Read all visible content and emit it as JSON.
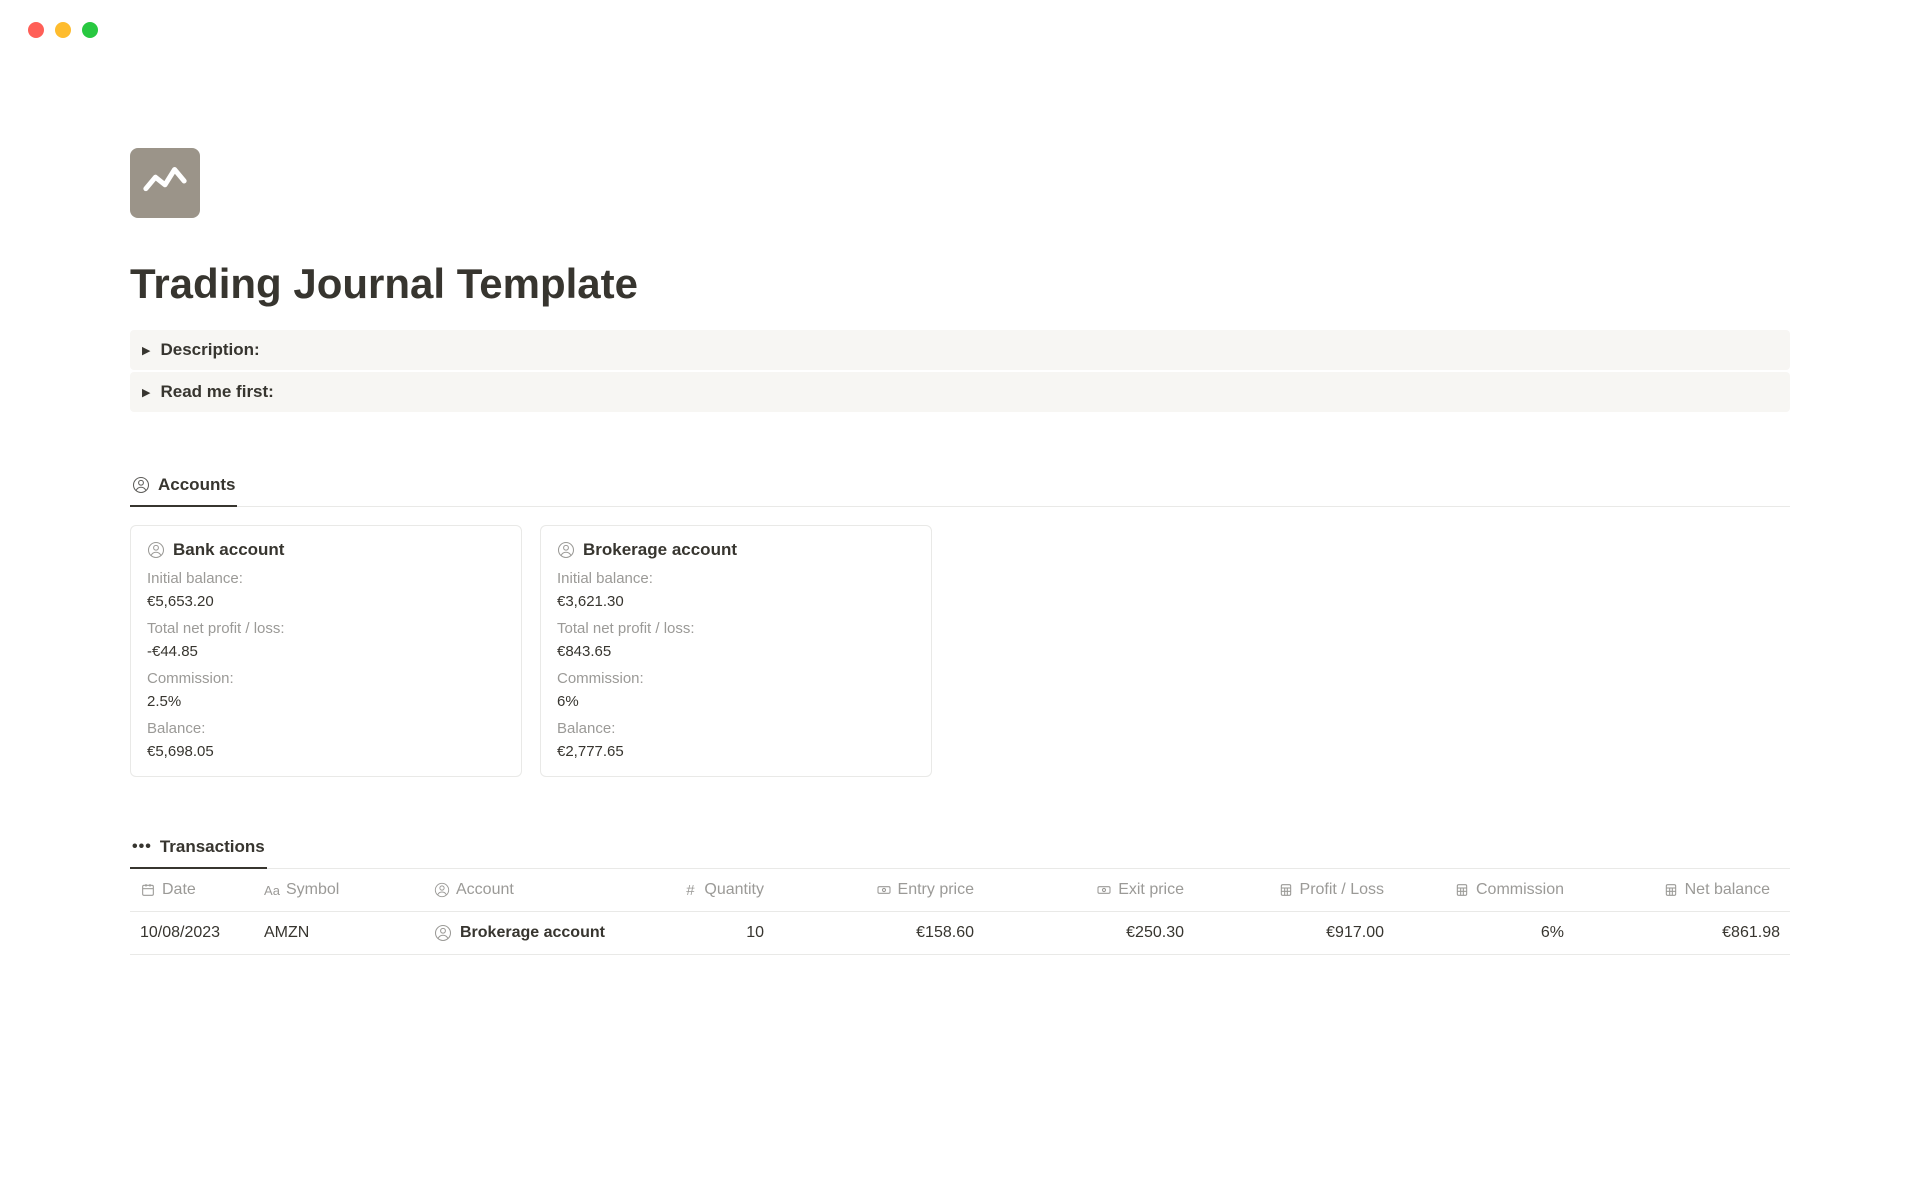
{
  "page": {
    "title": "Trading Journal Template"
  },
  "toggles": [
    {
      "label": "Description:"
    },
    {
      "label": "Read me first:"
    }
  ],
  "accounts": {
    "tab_label": "Accounts",
    "cards": [
      {
        "name": "Bank account",
        "initial_balance_label": "Initial balance:",
        "initial_balance": "€5,653.20",
        "net_label": "Total net profit / loss:",
        "net": "-€44.85",
        "commission_label": "Commission:",
        "commission": "2.5%",
        "balance_label": "Balance:",
        "balance": "€5,698.05"
      },
      {
        "name": "Brokerage account",
        "initial_balance_label": "Initial balance:",
        "initial_balance": "€3,621.30",
        "net_label": "Total net profit / loss:",
        "net": "€843.65",
        "commission_label": "Commission:",
        "commission": "6%",
        "balance_label": "Balance:",
        "balance": "€2,777.65"
      }
    ]
  },
  "transactions": {
    "tab_label": "Transactions",
    "headers": {
      "date": "Date",
      "symbol": "Symbol",
      "account": "Account",
      "quantity": "Quantity",
      "entry": "Entry price",
      "exit": "Exit price",
      "profit": "Profit / Loss",
      "commission": "Commission",
      "net": "Net balance"
    },
    "rows": [
      {
        "date": "10/08/2023",
        "symbol": "AMZN",
        "account": "Brokerage account",
        "quantity": "10",
        "entry": "€158.60",
        "exit": "€250.30",
        "profit": "€917.00",
        "commission": "6%",
        "net": "€861.98"
      }
    ]
  }
}
